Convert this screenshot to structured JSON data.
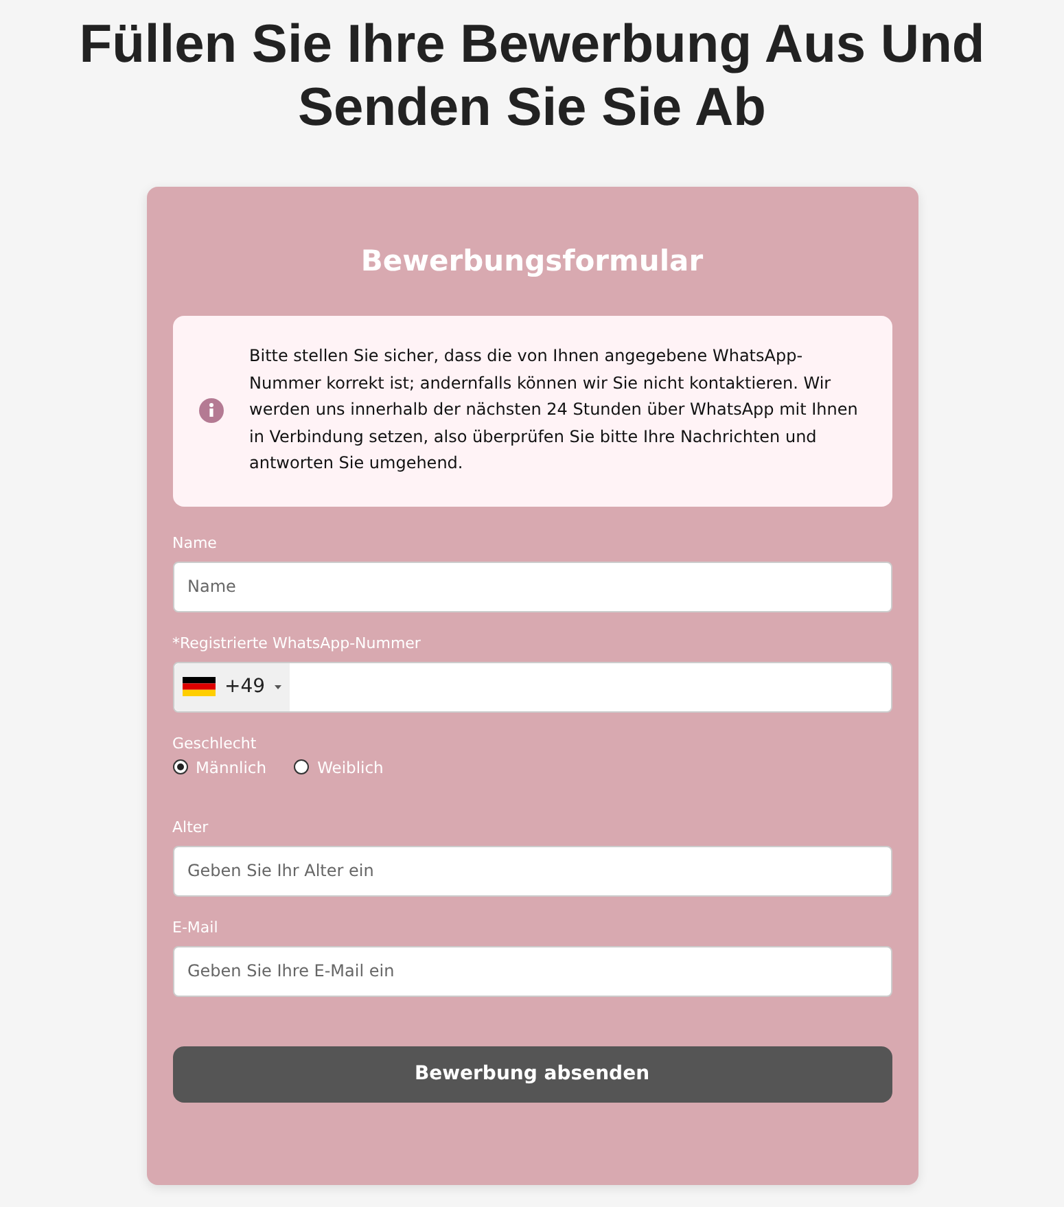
{
  "heading": "Füllen Sie Ihre Bewerbung Aus Und Senden Sie Sie Ab",
  "form": {
    "title": "Bewerbungsformular",
    "notice": "Bitte stellen Sie sicher, dass die von Ihnen angegebene WhatsApp-Nummer korrekt ist; andernfalls können wir Sie nicht kontaktieren. Wir werden uns innerhalb der nächsten 24 Stunden über WhatsApp mit Ihnen in Verbindung setzen, also überprüfen Sie bitte Ihre Nachrichten und antworten Sie umgehend.",
    "fields": [
      {
        "kind": "text",
        "label": "Name",
        "placeholder": "Name"
      },
      {
        "kind": "phone",
        "label": "*Registrierte WhatsApp-Nummer",
        "code": "+49"
      },
      {
        "kind": "radio",
        "label": "Geschlecht",
        "options": [
          {
            "label": "Männlich",
            "selected": true
          },
          {
            "label": "Weiblich",
            "selected": false
          }
        ]
      },
      {
        "kind": "text",
        "label": "Alter",
        "placeholder": "Geben Sie Ihr Alter ein"
      },
      {
        "kind": "text",
        "label": "E-Mail",
        "placeholder": "Geben Sie Ihre E-Mail ein"
      }
    ],
    "submit": "Bewerbung absenden"
  }
}
